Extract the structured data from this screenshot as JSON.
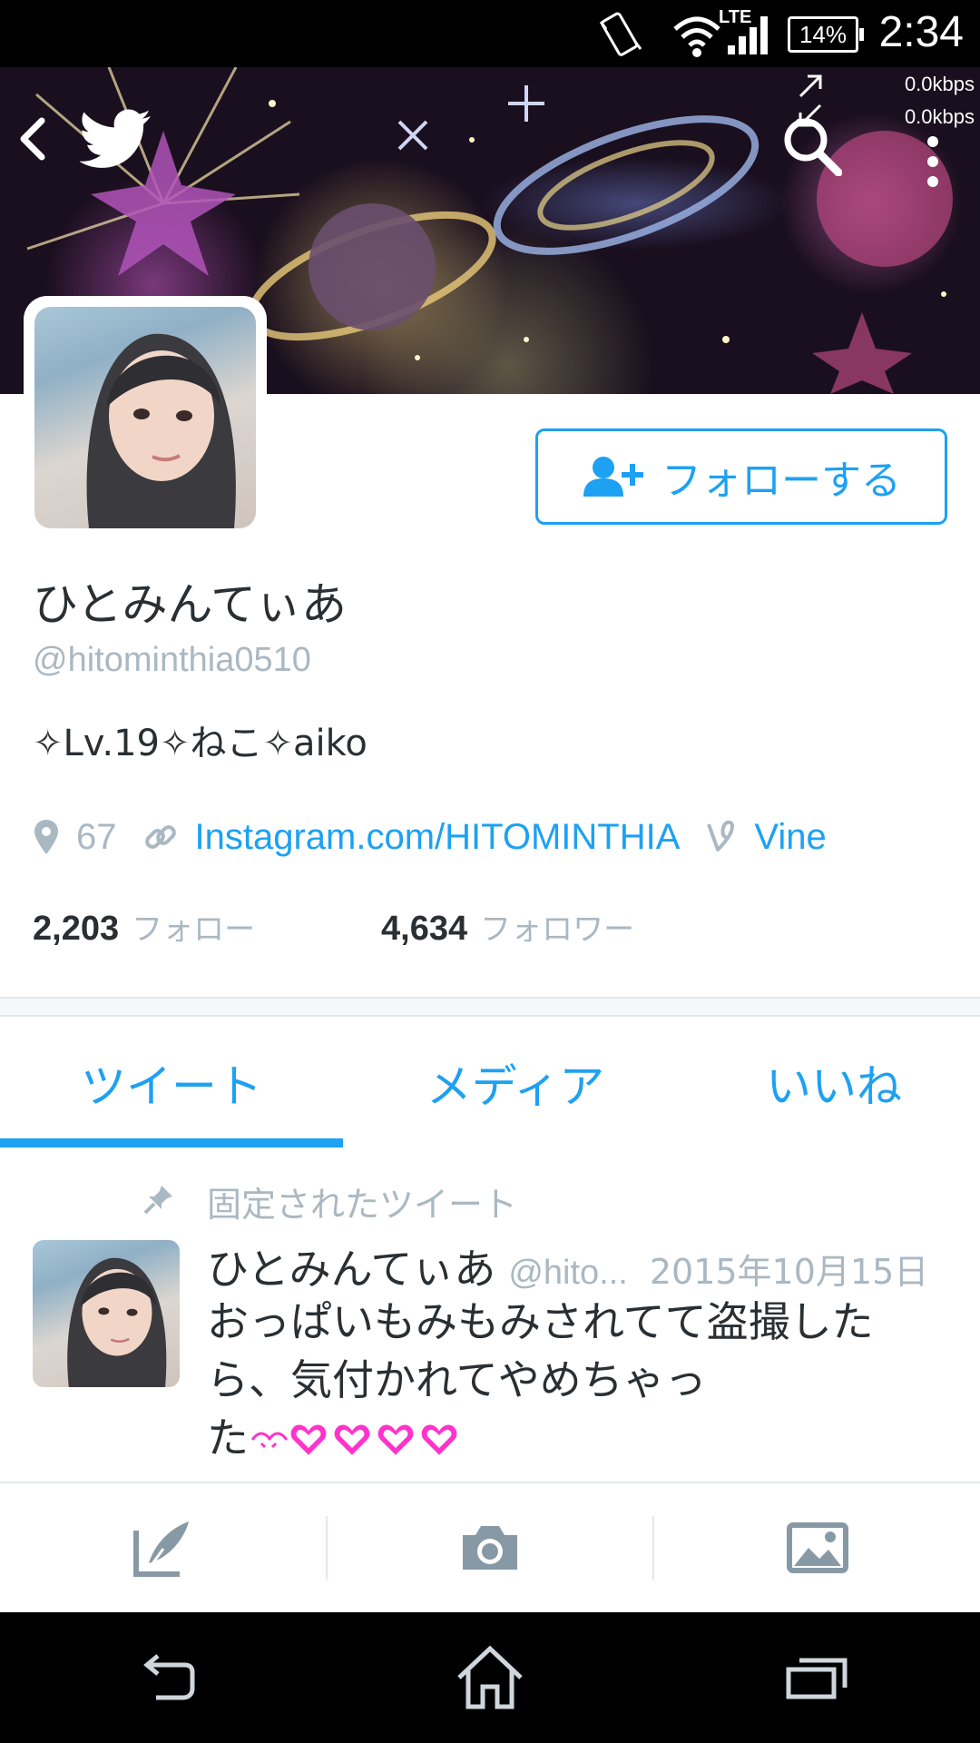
{
  "status_bar": {
    "network_type": "LTE",
    "battery": "14%",
    "time": "2:34",
    "upload_speed": "0.0kbps",
    "download_speed": "0.0kbps"
  },
  "profile": {
    "display_name": "ひとみんてぃあ",
    "handle": "@hitominthia0510",
    "bio": "✧Lv.19✧ねこ✧aiko",
    "location": "67",
    "website": "Instagram.com/HITOMINTHIA",
    "vine": "Vine",
    "following_count": "2,203",
    "following_label": "フォロー",
    "followers_count": "4,634",
    "followers_label": "フォロワー",
    "follow_button_label": "フォローする"
  },
  "tabs": [
    {
      "label": "ツイート",
      "active": true
    },
    {
      "label": "メディア",
      "active": false
    },
    {
      "label": "いいね",
      "active": false
    }
  ],
  "pinned_tweet": {
    "pinned_label": "固定されたツイート",
    "author_name": "ひとみんてぃあ",
    "author_handle": "@hito...",
    "date": "2015年10月15日",
    "text_line1": "おっぱいもみもみされてて盗撮した",
    "text_line2": "ら、気付かれてやめちゃっ",
    "text_line3": "た"
  },
  "colors": {
    "accent": "#1da1f2",
    "muted": "#aab8c2",
    "text": "#292f33",
    "heart": "#ff33cc"
  },
  "icons": [
    "back-arrow-icon",
    "twitter-bird-icon",
    "search-icon",
    "overflow-menu-icon",
    "add-user-icon",
    "location-pin-icon",
    "link-icon",
    "vine-icon",
    "pin-icon",
    "compose-icon",
    "camera-icon",
    "image-icon",
    "nav-back-icon",
    "nav-home-icon",
    "nav-recents-icon"
  ]
}
